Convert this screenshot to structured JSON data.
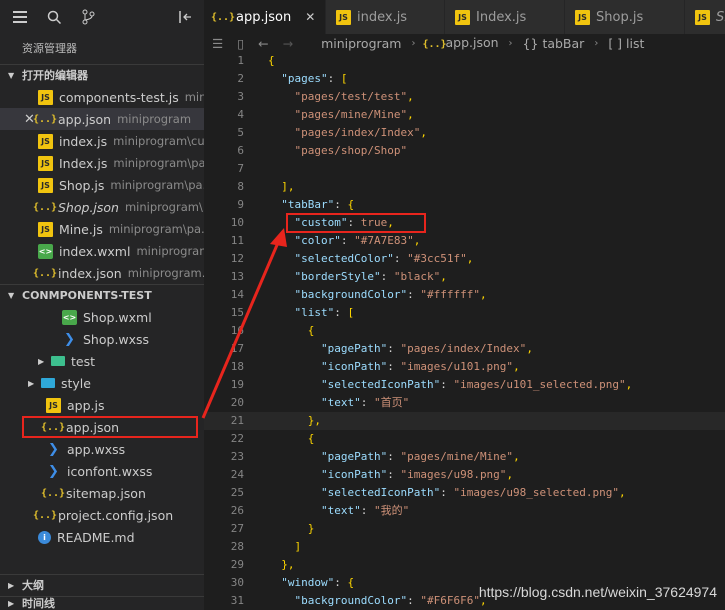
{
  "sidebar": {
    "title": "资源管理器",
    "open_editors": {
      "header": "打开的编辑器",
      "items": [
        {
          "name": "components-test.js",
          "desc": "mini...",
          "type": "js"
        },
        {
          "name": "app.json",
          "desc": "miniprogram",
          "type": "json"
        },
        {
          "name": "index.js",
          "desc": "miniprogram\\cu...",
          "type": "js"
        },
        {
          "name": "Index.js",
          "desc": "miniprogram\\pa...",
          "type": "js"
        },
        {
          "name": "Shop.js",
          "desc": "miniprogram\\pa...",
          "type": "js"
        },
        {
          "name": "Shop.json",
          "desc": "miniprogram\\...",
          "type": "json"
        },
        {
          "name": "Mine.js",
          "desc": "miniprogram\\pa...",
          "type": "js"
        },
        {
          "name": "index.wxml",
          "desc": "miniprogram\\...",
          "type": "wxml"
        },
        {
          "name": "index.json",
          "desc": "miniprogram...",
          "type": "json"
        }
      ]
    },
    "project": {
      "header": "CONMPONENTS-TEST",
      "items": [
        {
          "name": "Shop.wxml",
          "type": "wxml"
        },
        {
          "name": "Shop.wxss",
          "type": "wxss"
        },
        {
          "name": "test",
          "type": "folder"
        },
        {
          "name": "style",
          "type": "folder"
        },
        {
          "name": "app.js",
          "type": "js"
        },
        {
          "name": "app.json",
          "type": "json"
        },
        {
          "name": "app.wxss",
          "type": "wxss"
        },
        {
          "name": "iconfont.wxss",
          "type": "wxss"
        },
        {
          "name": "sitemap.json",
          "type": "json"
        },
        {
          "name": "project.config.json",
          "type": "json"
        },
        {
          "name": "README.md",
          "type": "info"
        }
      ]
    },
    "outline": "大纲",
    "timeline": "时间线"
  },
  "tabs": [
    {
      "label": "app.json",
      "icon": "json"
    },
    {
      "label": "index.js",
      "icon": "js"
    },
    {
      "label": "Index.js",
      "icon": "js"
    },
    {
      "label": "Shop.js",
      "icon": "js"
    },
    {
      "label": "Sh",
      "icon": "js"
    }
  ],
  "breadcrumb": [
    "miniprogram",
    "app.json",
    "tabBar",
    "list"
  ],
  "code_lines": [
    {
      "n": "1",
      "t": "{"
    },
    {
      "n": "2",
      "t": "  \"pages\": ["
    },
    {
      "n": "3",
      "t": "    \"pages/test/test\","
    },
    {
      "n": "4",
      "t": "    \"pages/mine/Mine\","
    },
    {
      "n": "5",
      "t": "    \"pages/index/Index\","
    },
    {
      "n": "6",
      "t": "    \"pages/shop/Shop\""
    },
    {
      "n": "7",
      "t": ""
    },
    {
      "n": "8",
      "t": "  ],"
    },
    {
      "n": "9",
      "t": "  \"tabBar\": {"
    },
    {
      "n": "10",
      "t": "    \"custom\": true,"
    },
    {
      "n": "11",
      "t": "    \"color\": \"#7A7E83\","
    },
    {
      "n": "12",
      "t": "    \"selectedColor\": \"#3cc51f\","
    },
    {
      "n": "13",
      "t": "    \"borderStyle\": \"black\","
    },
    {
      "n": "14",
      "t": "    \"backgroundColor\": \"#ffffff\","
    },
    {
      "n": "15",
      "t": "    \"list\": ["
    },
    {
      "n": "16",
      "t": "      {"
    },
    {
      "n": "17",
      "t": "        \"pagePath\": \"pages/index/Index\","
    },
    {
      "n": "18",
      "t": "        \"iconPath\": \"images/u101.png\","
    },
    {
      "n": "19",
      "t": "        \"selectedIconPath\": \"images/u101_selected.png\","
    },
    {
      "n": "20",
      "t": "        \"text\": \"首页\""
    },
    {
      "n": "21",
      "t": "      },"
    },
    {
      "n": "22",
      "t": "      {"
    },
    {
      "n": "23",
      "t": "        \"pagePath\": \"pages/mine/Mine\","
    },
    {
      "n": "24",
      "t": "        \"iconPath\": \"images/u98.png\","
    },
    {
      "n": "25",
      "t": "        \"selectedIconPath\": \"images/u98_selected.png\","
    },
    {
      "n": "26",
      "t": "        \"text\": \"我的\""
    },
    {
      "n": "27",
      "t": "      }"
    },
    {
      "n": "28",
      "t": "    ]"
    },
    {
      "n": "29",
      "t": "  },"
    },
    {
      "n": "30",
      "t": "  \"window\": {"
    },
    {
      "n": "31",
      "t": "    \"backgroundColor\": \"#F6F6F6\","
    }
  ],
  "watermark": "https://blog.csdn.net/weixin_37624974",
  "colors": {
    "highlight_box": "#e8251d",
    "key": "#9cdcfe",
    "string": "#ce9178"
  }
}
